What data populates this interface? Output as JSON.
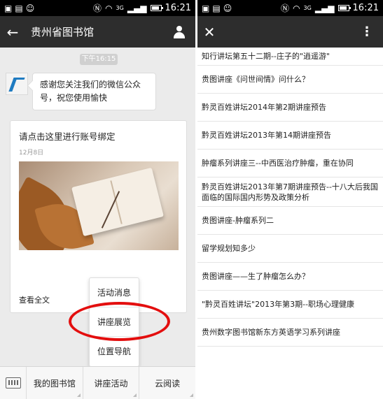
{
  "status_bar": {
    "time": "16:21",
    "signal_label": "3G"
  },
  "left_screen": {
    "header": {
      "title": "贵州省图书馆",
      "back_icon": "arrow-left-icon",
      "profile_icon": "person-icon"
    },
    "timestamp": "下午16:15",
    "welcome_message": "感谢您关注我们的微信公众号，祝您使用愉快",
    "card": {
      "title": "请点击这里进行账号绑定",
      "date": "12月8日",
      "read_more": "查看全文"
    },
    "popup_menu": [
      "活动消息",
      "讲座展览",
      "位置导航"
    ],
    "bottom_tabs": [
      "我的图书馆",
      "讲座活动",
      "云阅读"
    ],
    "highlight_color": "#e30e0e"
  },
  "right_screen": {
    "header": {
      "close_icon": "close-icon",
      "more_icon": "more-vertical-icon"
    },
    "articles": [
      "知行讲坛第五十二期--庄子的\"逍遥游\"",
      "贵图讲座《问世间情》问什么？",
      "黔灵百姓讲坛2014年第2期讲座预告",
      "黔灵百姓讲坛2013年第14期讲座预告",
      "肿瘤系列讲座三--中西医治疗肿瘤，重在协同",
      "黔灵百姓讲坛2013年第7期讲座预告--十八大后我国面临的国际国内形势及政策分析",
      "贵图讲座-肿瘤系列二",
      "留学规划知多少",
      "贵图讲座——生了肿瘤怎么办？",
      "\"黔灵百姓讲坛\"2013年第3期--职场心理健康",
      "贵州数字图书馆新东方英语学习系列讲座"
    ]
  }
}
